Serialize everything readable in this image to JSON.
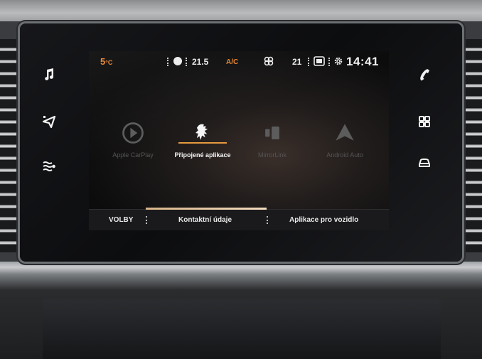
{
  "status_bar": {
    "outside_temp": "5",
    "outside_temp_unit": "°C",
    "driver_temp": "21.5",
    "ac_label": "A/C",
    "fan_icon": "fan-icon",
    "passenger_temp": "21",
    "time": "14:41"
  },
  "side_buttons": {
    "left": [
      {
        "icon": "music-note-icon"
      },
      {
        "icon": "navigation-icon"
      },
      {
        "icon": "climate-icon"
      }
    ],
    "right": [
      {
        "icon": "phone-icon"
      },
      {
        "icon": "apps-grid-icon"
      },
      {
        "icon": "car-icon"
      }
    ]
  },
  "apps": [
    {
      "label": "Apple CarPlay",
      "icon": "carplay-play-icon",
      "state": "disabled"
    },
    {
      "label": "Připojené aplikace",
      "icon": "peugeot-lion-icon",
      "state": "active"
    },
    {
      "label": "MirrorLink",
      "icon": "mirrorlink-icon",
      "state": "disabled"
    },
    {
      "label": "Android Auto",
      "icon": "android-auto-icon",
      "state": "disabled"
    }
  ],
  "bottom_bar": {
    "options_label": "VOLBY",
    "contact_label": "Kontaktní údaje",
    "vehicle_apps_label": "Aplikace pro vozidlo"
  },
  "colors": {
    "accent": "#e7852f",
    "underline": "#e59a3e"
  }
}
